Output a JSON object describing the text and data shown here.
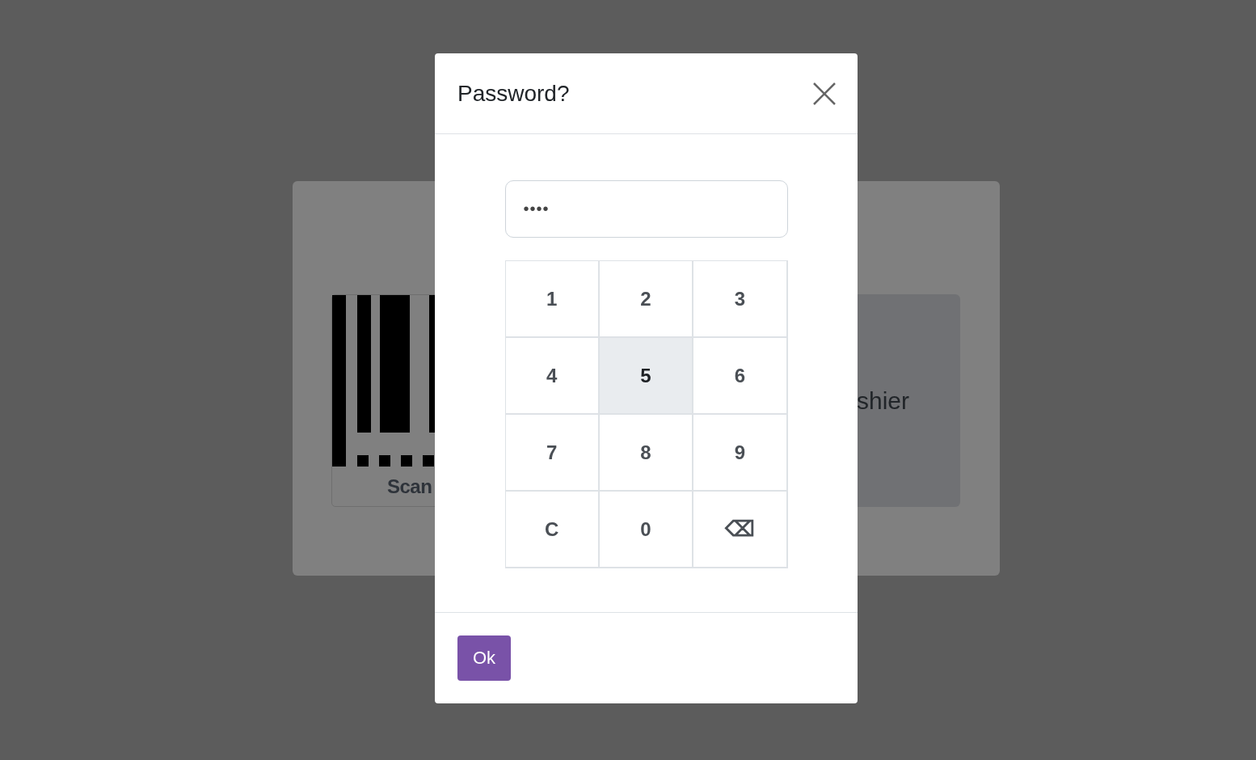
{
  "background": {
    "scan_card": {
      "label": "Scan"
    },
    "cashier_card": {
      "label": "shier"
    }
  },
  "dialog": {
    "title": "Password?",
    "password": {
      "value": "••••"
    },
    "keys": [
      {
        "label": "1",
        "kind": "digit",
        "selected": false
      },
      {
        "label": "2",
        "kind": "digit",
        "selected": false
      },
      {
        "label": "3",
        "kind": "digit",
        "selected": false
      },
      {
        "label": "4",
        "kind": "digit",
        "selected": false
      },
      {
        "label": "5",
        "kind": "digit",
        "selected": true
      },
      {
        "label": "6",
        "kind": "digit",
        "selected": false
      },
      {
        "label": "7",
        "kind": "digit",
        "selected": false
      },
      {
        "label": "8",
        "kind": "digit",
        "selected": false
      },
      {
        "label": "9",
        "kind": "digit",
        "selected": false
      },
      {
        "label": "C",
        "kind": "clear",
        "selected": false
      },
      {
        "label": "0",
        "kind": "digit",
        "selected": false
      },
      {
        "label": "⌫",
        "kind": "backspace",
        "selected": false
      }
    ],
    "buttons": [
      {
        "label": "Ok"
      }
    ]
  }
}
